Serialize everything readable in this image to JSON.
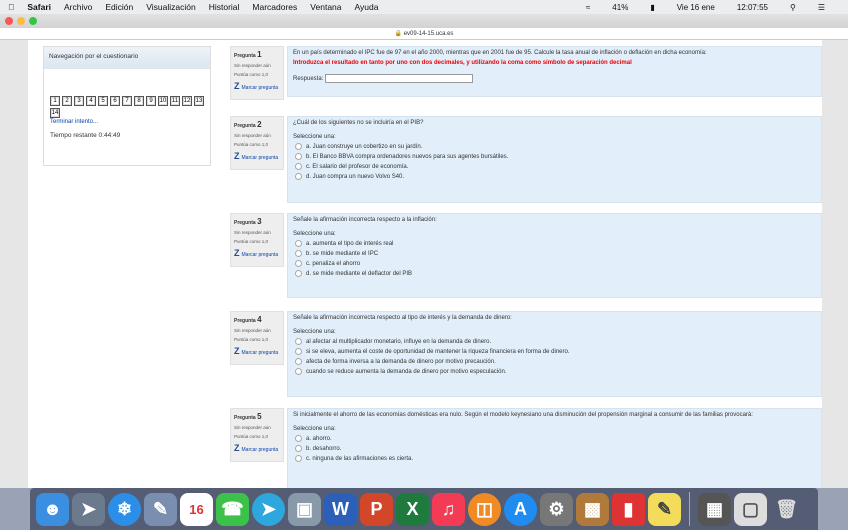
{
  "menubar": {
    "items": [
      "Safari",
      "Archivo",
      "Edición",
      "Visualización",
      "Historial",
      "Marcadores",
      "Ventana",
      "Ayuda"
    ],
    "battery": "41%",
    "date": "Vie 16 ene",
    "time": "12:07:55"
  },
  "browser": {
    "url": "ev09-14-15.uca.es"
  },
  "nav": {
    "title": "Navegación por el cuestionario",
    "pages": [
      "1",
      "2",
      "3",
      "4",
      "5",
      "6",
      "7",
      "8",
      "9",
      "10",
      "11",
      "12",
      "13",
      "14"
    ],
    "finish": "Terminar intento...",
    "timer": "Tiempo restante 0:44:49"
  },
  "common": {
    "status": "Sin responder aún",
    "flag": "Marcar pregunta",
    "select": "Seleccione una:",
    "question_label": "Pregunta"
  },
  "questions": [
    {
      "number": "1",
      "points": "Puntúa como 1,0",
      "text": "En un país determinado el IPC fue de 97 en el año 2000, mientras que en 2001 fue de 95. Calcule la tasa anual de inflación o deflación en dicha economía:",
      "note": "Introduzca el resultado en tanto por uno con dos decimales, y utilizando la coma como símbolo de separación decimal",
      "answer_label": "Respuesta:",
      "answer_value": ""
    },
    {
      "number": "2",
      "points": "Puntúa como 1,0",
      "text": "¿Cuál de los siguientes no se incluiría en el PIB?",
      "options": [
        "a. Juan construye un cobertizo en su jardín.",
        "b. El Banco BBVA compra ordenadores nuevos para sus agentes bursátiles.",
        "c. El salario del profesor de economía.",
        "d. Juan compra un nuevo Volvo S40."
      ]
    },
    {
      "number": "3",
      "points": "Puntúa como 1,0",
      "text": "Señale la afirmación incorrecta respecto a la inflación:",
      "options": [
        "a. aumenta el tipo de interés real",
        "b. se mide mediante el IPC",
        "c. penaliza el ahorro",
        "d. se mide mediante el deflactor del PIB"
      ]
    },
    {
      "number": "4",
      "points": "Puntúa como 1,0",
      "text": "Señale la afirmación incorrecta respecto al tipo de interés y la demanda de dinero:",
      "options": [
        "al afectar al multiplicador monetario, influye en la demanda de dinero.",
        "si se eleva, aumenta el coste de oportunidad de mantener la riqueza financiera en forma de dinero.",
        "afecta de forma inversa a la demanda de dinero por motivo precaución.",
        "cuando se reduce aumenta la demanda de dinero por motivo especulación."
      ]
    },
    {
      "number": "5",
      "points": "Puntúa como 1,0",
      "text": "Si inicialmente el ahorro de las economías domésticas era nulo. Según el modelo keynesiano una disminución del propensión marginal a consumir de las familias provocará:",
      "options": [
        "a. ahorro.",
        "b. desahorro.",
        "c. ninguna de las afirmaciones es cierta."
      ]
    }
  ],
  "dock": {
    "calendar_day": "16"
  }
}
